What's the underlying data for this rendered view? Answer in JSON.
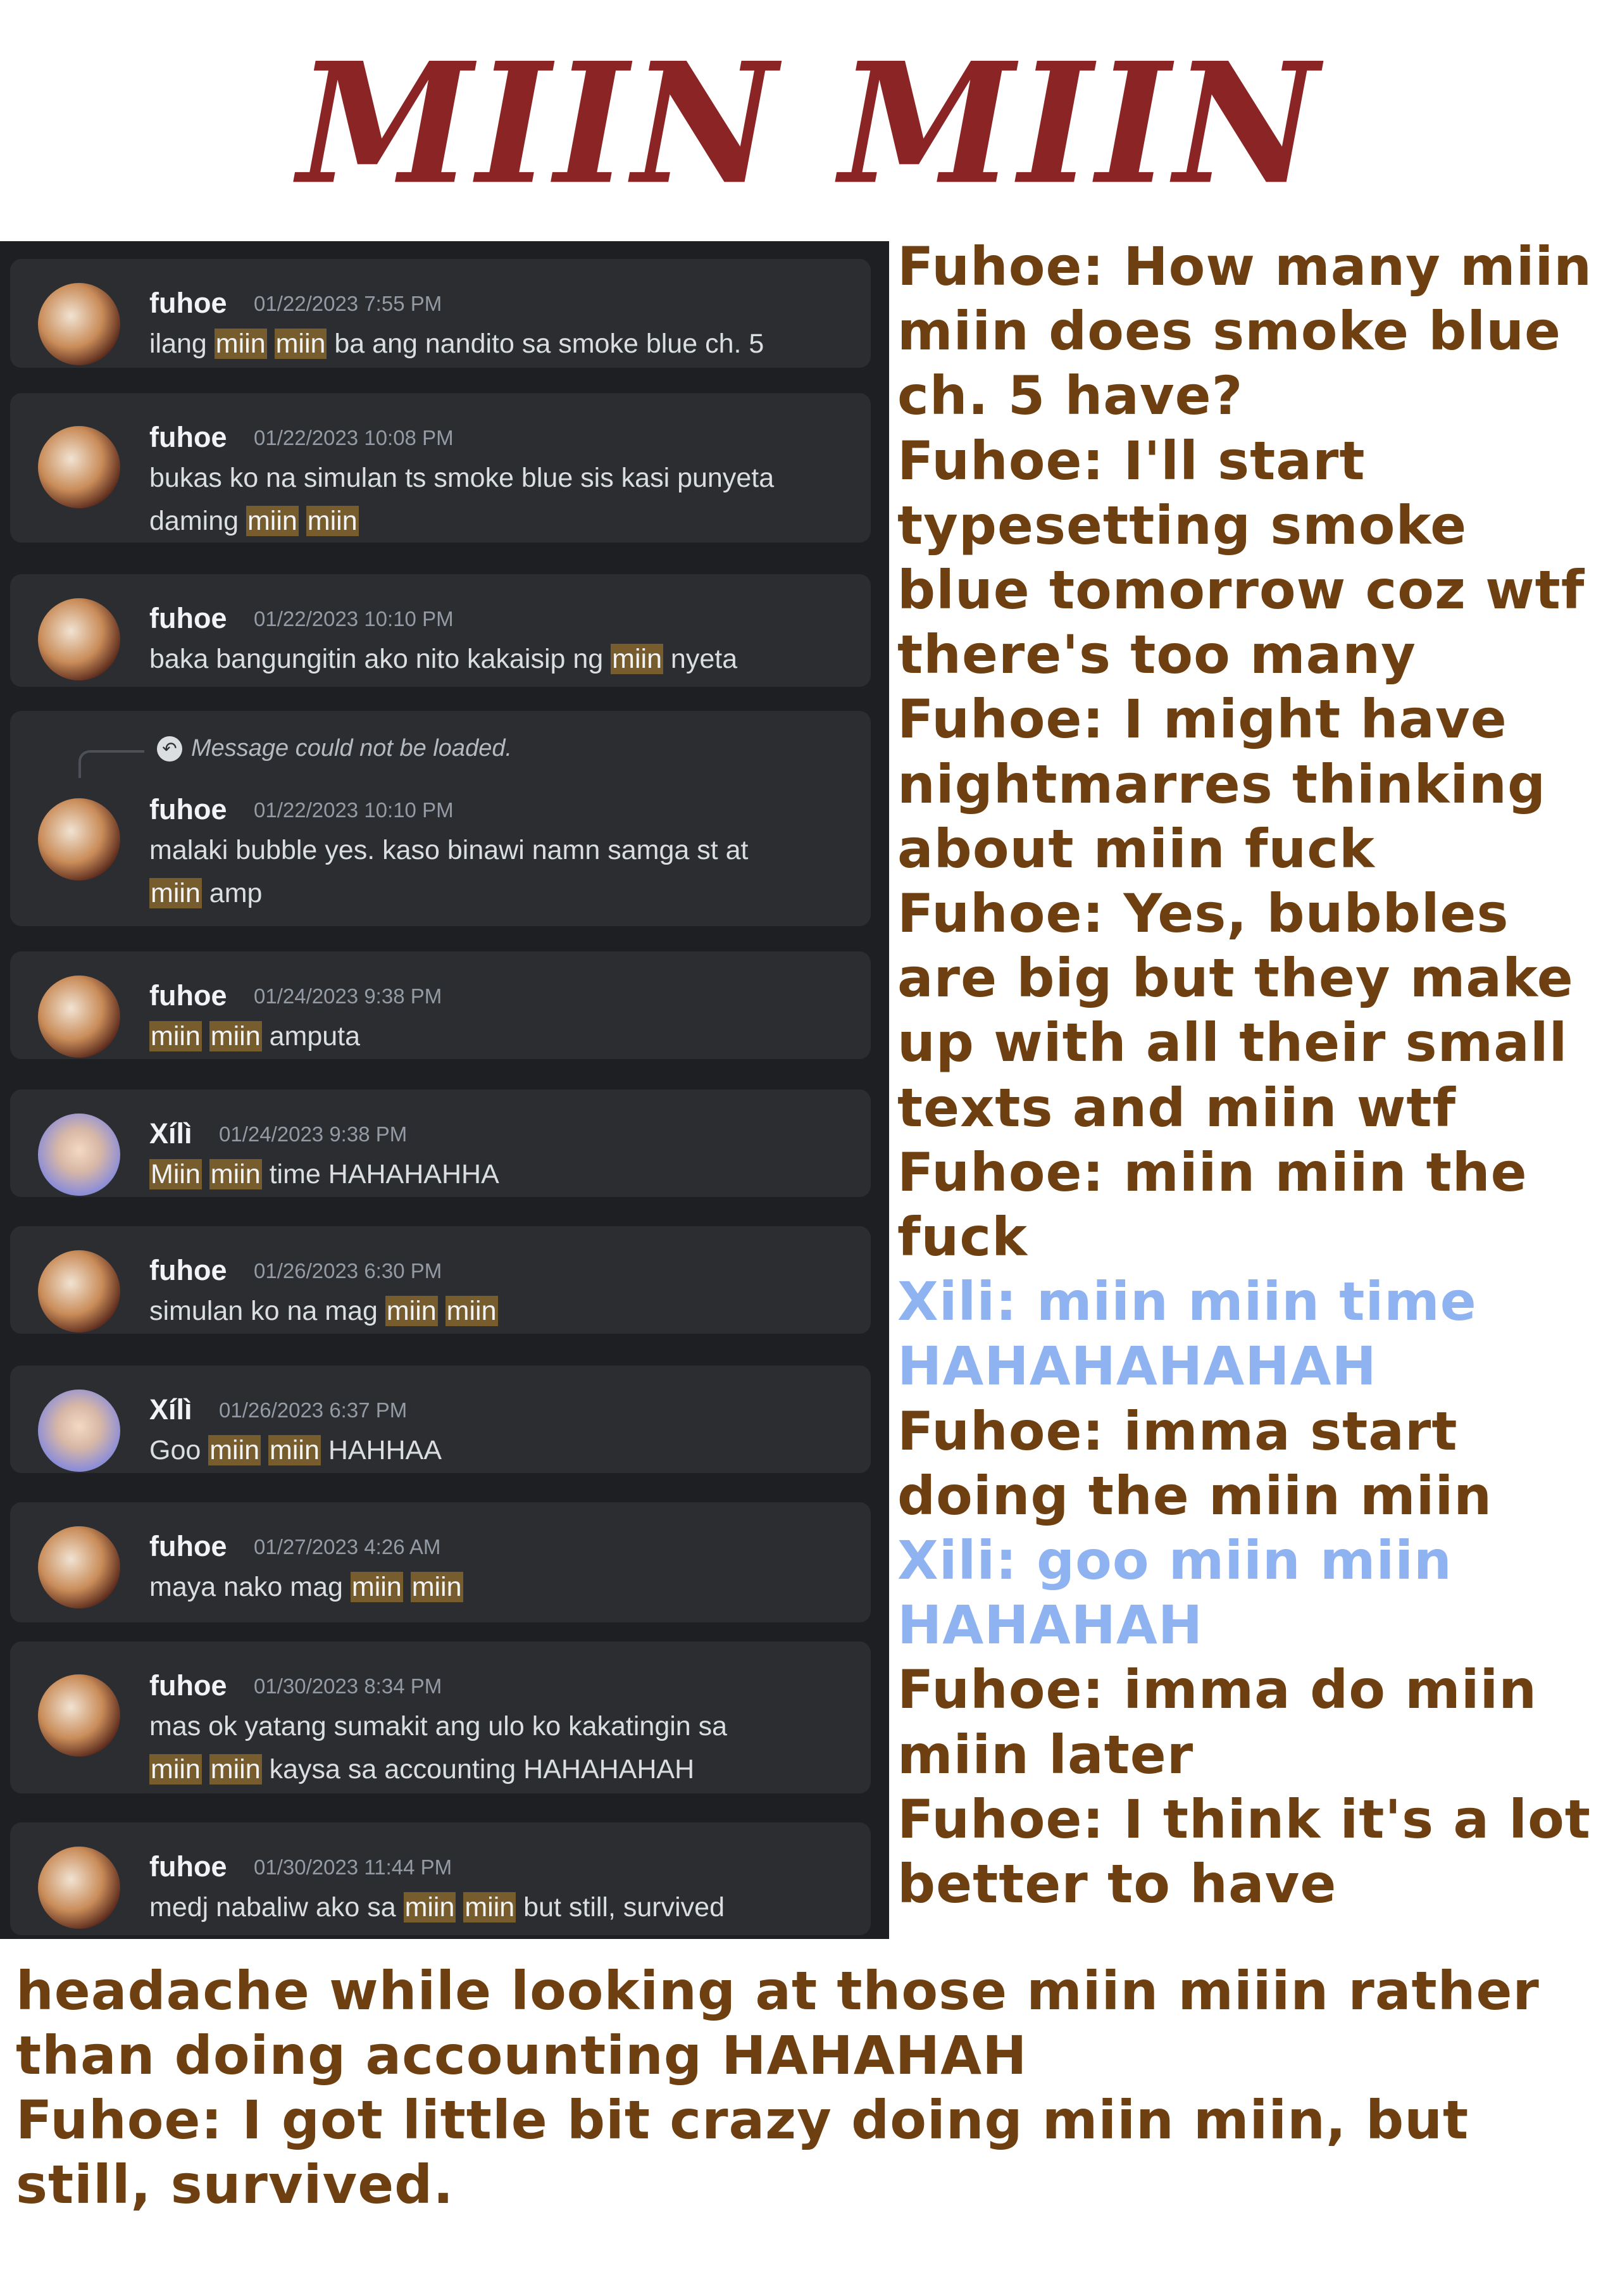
{
  "title": "MIIN MIIN",
  "chat": [
    {
      "user": "fuhoe",
      "time": "01/22/2023 7:55 PM",
      "lines": [
        [
          [
            "ilang ",
            0
          ],
          [
            "miin",
            1
          ],
          [
            " ",
            0
          ],
          [
            "miin",
            1
          ],
          [
            " ba ang nandito sa smoke blue ch. 5",
            0
          ]
        ]
      ]
    },
    {
      "user": "fuhoe",
      "time": "01/22/2023 10:08 PM",
      "lines": [
        [
          [
            "bukas ko na simulan ts smoke blue sis kasi punyeta",
            0
          ]
        ],
        [
          [
            "daming ",
            0
          ],
          [
            "miin",
            1
          ],
          [
            " ",
            0
          ],
          [
            "miin",
            1
          ]
        ]
      ]
    },
    {
      "user": "fuhoe",
      "time": "01/22/2023 10:10 PM",
      "lines": [
        [
          [
            "baka bangungitin ako nito kakaisip ng ",
            0
          ],
          [
            "miin",
            1
          ],
          [
            " nyeta",
            0
          ]
        ]
      ]
    },
    {
      "user": "fuhoe",
      "time": "01/22/2023 10:10 PM",
      "reply_note": "Message could not be loaded.",
      "lines": [
        [
          [
            "malaki bubble yes. kaso binawi namn samga st at",
            0
          ]
        ],
        [
          [
            "miin",
            1
          ],
          [
            " amp",
            0
          ]
        ]
      ]
    },
    {
      "user": "fuhoe",
      "time": "01/24/2023 9:38 PM",
      "lines": [
        [
          [
            "miin",
            1
          ],
          [
            " ",
            0
          ],
          [
            "miin",
            1
          ],
          [
            " amputa",
            0
          ]
        ]
      ]
    },
    {
      "user": "Xílì",
      "time": "01/24/2023 9:38 PM",
      "lines": [
        [
          [
            "Miin",
            1
          ],
          [
            " ",
            0
          ],
          [
            "miin",
            1
          ],
          [
            " time HAHAHAHHA",
            0
          ]
        ]
      ]
    },
    {
      "user": "fuhoe",
      "time": "01/26/2023 6:30 PM",
      "lines": [
        [
          [
            "simulan ko na mag ",
            0
          ],
          [
            "miin",
            1
          ],
          [
            " ",
            0
          ],
          [
            "miin",
            1
          ]
        ]
      ]
    },
    {
      "user": "Xílì",
      "time": "01/26/2023 6:37 PM",
      "lines": [
        [
          [
            "Goo ",
            0
          ],
          [
            "miin",
            1
          ],
          [
            " ",
            0
          ],
          [
            "miin",
            1
          ],
          [
            " HAHHAA",
            0
          ]
        ]
      ]
    },
    {
      "user": "fuhoe",
      "time": "01/27/2023 4:26 AM",
      "lines": [
        [
          [
            "maya nako mag ",
            0
          ],
          [
            "miin",
            1
          ],
          [
            " ",
            0
          ],
          [
            "miin",
            1
          ]
        ]
      ]
    },
    {
      "user": "fuhoe",
      "time": "01/30/2023 8:34 PM",
      "lines": [
        [
          [
            "mas ok yatang sumakit ang ulo ko kakatingin sa",
            0
          ]
        ],
        [
          [
            "miin",
            1
          ],
          [
            " ",
            0
          ],
          [
            "miin",
            1
          ],
          [
            " kaysa sa accounting HAHAHAHAH",
            0
          ]
        ]
      ]
    },
    {
      "user": "fuhoe",
      "time": "01/30/2023 11:44 PM",
      "lines": [
        [
          [
            "medj nabaliw ako sa ",
            0
          ],
          [
            "miin",
            1
          ],
          [
            " ",
            0
          ],
          [
            "miin",
            1
          ],
          [
            " but still, survived",
            0
          ]
        ]
      ]
    }
  ],
  "translation_right": [
    {
      "speaker": "fuhoe",
      "text": "Fuhoe: How many miin"
    },
    {
      "speaker": "fuhoe",
      "text": "miin does smoke blue"
    },
    {
      "speaker": "fuhoe",
      "text": "ch. 5 have?"
    },
    {
      "speaker": "fuhoe",
      "text": "Fuhoe: I'll start"
    },
    {
      "speaker": "fuhoe",
      "text": "typesetting smoke"
    },
    {
      "speaker": "fuhoe",
      "text": "blue tomorrow coz wtf"
    },
    {
      "speaker": "fuhoe",
      "text": "there's too many"
    },
    {
      "speaker": "fuhoe",
      "text": "Fuhoe: I might have"
    },
    {
      "speaker": "fuhoe",
      "text": "nightmarres thinking"
    },
    {
      "speaker": "fuhoe",
      "text": "about miin fuck"
    },
    {
      "speaker": "fuhoe",
      "text": "Fuhoe: Yes, bubbles"
    },
    {
      "speaker": "fuhoe",
      "text": "are big but they make"
    },
    {
      "speaker": "fuhoe",
      "text": "up with all their small"
    },
    {
      "speaker": "fuhoe",
      "text": "texts and miin wtf"
    },
    {
      "speaker": "fuhoe",
      "text": "Fuhoe: miin miin the"
    },
    {
      "speaker": "fuhoe",
      "text": "fuck"
    },
    {
      "speaker": "xili",
      "text": "Xili: miin miin time"
    },
    {
      "speaker": "xili",
      "text": "HAHAHAHAHAH"
    },
    {
      "speaker": "fuhoe",
      "text": "Fuhoe: imma start"
    },
    {
      "speaker": "fuhoe",
      "text": "doing the miin miin"
    },
    {
      "speaker": "xili",
      "text": "Xili: goo miin miin"
    },
    {
      "speaker": "xili",
      "text": "HAHAHAH"
    },
    {
      "speaker": "fuhoe",
      "text": "Fuhoe: imma do miin"
    },
    {
      "speaker": "fuhoe",
      "text": "miin later"
    },
    {
      "speaker": "fuhoe",
      "text": "Fuhoe: I think it's a lot"
    },
    {
      "speaker": "fuhoe",
      "text": "better to have"
    }
  ],
  "translation_bottom": [
    {
      "speaker": "fuhoe",
      "text": "headache while looking at those miin miiin rather"
    },
    {
      "speaker": "fuhoe",
      "text": "than doing accounting HAHAHAH"
    },
    {
      "speaker": "fuhoe",
      "text": "Fuhoe: I got little bit crazy doing miin miin, but"
    },
    {
      "speaker": "fuhoe",
      "text": "still, survived."
    }
  ],
  "colors": {
    "title": "#8b2525",
    "fuhoe_text": "#6e3f10",
    "xili_text": "#8fb2f0",
    "highlight": "#775d2d",
    "chat_bg": "#1e1f22",
    "message_bg": "#2b2d31"
  }
}
